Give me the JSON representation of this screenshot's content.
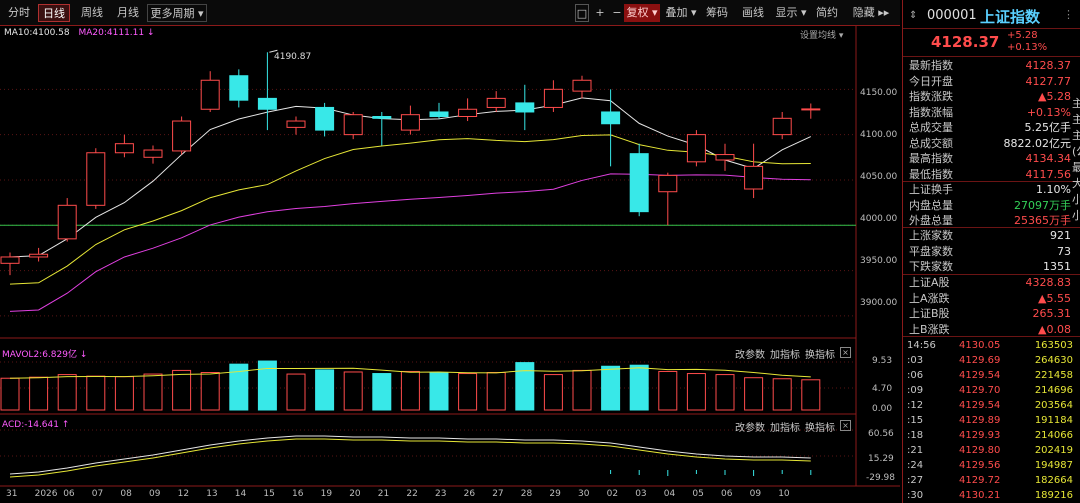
{
  "toolbar": {
    "periods": [
      "分时",
      "日线",
      "周线",
      "月线",
      "更多周期 ▾"
    ],
    "active_period": "日线",
    "icons": [
      "□",
      "+",
      "−"
    ],
    "adjust": "复权 ▾",
    "items": [
      "叠加 ▾",
      "筹码",
      "画线",
      "显示 ▾",
      "简约",
      "隐藏 ▸▸"
    ]
  },
  "ma": {
    "ma10": "MA10:4100.58",
    "ma20": "MA20:4111.11 ↓"
  },
  "settings_label": "设置均线 ▾",
  "high_marker": "4190.87",
  "y_axis_main": [
    "4150.00",
    "4100.00",
    "4050.00",
    "4000.00",
    "3950.00",
    "3900.00"
  ],
  "vol_panel": {
    "label": "MAVOL2:6.829亿 ↓",
    "y": [
      "9.53",
      "4.70",
      "0.00"
    ],
    "buttons": [
      "改参数",
      "加指标",
      "换指标"
    ]
  },
  "macd_panel": {
    "label": "ACD:-14.641 ↑",
    "y": [
      "60.56",
      "15.29",
      "-29.98"
    ],
    "buttons": [
      "改参数",
      "加指标",
      "换指标"
    ]
  },
  "x_labels": [
    "31",
    "2026",
    "06",
    "07",
    "08",
    "09",
    "12",
    "13",
    "14",
    "15",
    "16",
    "19",
    "20",
    "21",
    "22",
    "23",
    "26",
    "27",
    "28",
    "29",
    "30",
    "02",
    "03",
    "04",
    "05",
    "06",
    "09",
    "10"
  ],
  "chart_data": {
    "type": "candlestick",
    "candles": [
      {
        "o": 3958,
        "h": 3970,
        "l": 3945,
        "c": 3965
      },
      {
        "o": 3965,
        "h": 3975,
        "l": 3960,
        "c": 3968
      },
      {
        "o": 3985,
        "h": 4030,
        "l": 3982,
        "c": 4022
      },
      {
        "o": 4022,
        "h": 4085,
        "l": 4018,
        "c": 4080
      },
      {
        "o": 4080,
        "h": 4100,
        "l": 4075,
        "c": 4090
      },
      {
        "o": 4075,
        "h": 4088,
        "l": 4068,
        "c": 4083
      },
      {
        "o": 4082,
        "h": 4120,
        "l": 4078,
        "c": 4115
      },
      {
        "o": 4128,
        "h": 4170,
        "l": 4125,
        "c": 4160
      },
      {
        "o": 4165,
        "h": 4172,
        "l": 4130,
        "c": 4138
      },
      {
        "o": 4140,
        "h": 4190.87,
        "l": 4105,
        "c": 4128
      },
      {
        "o": 4108,
        "h": 4120,
        "l": 4100,
        "c": 4115
      },
      {
        "o": 4130,
        "h": 4135,
        "l": 4098,
        "c": 4105
      },
      {
        "o": 4100,
        "h": 4125,
        "l": 4095,
        "c": 4122
      },
      {
        "o": 4120,
        "h": 4125,
        "l": 4088,
        "c": 4118
      },
      {
        "o": 4105,
        "h": 4132,
        "l": 4100,
        "c": 4122
      },
      {
        "o": 4125,
        "h": 4135,
        "l": 4118,
        "c": 4120
      },
      {
        "o": 4120,
        "h": 4140,
        "l": 4115,
        "c": 4128
      },
      {
        "o": 4130,
        "h": 4148,
        "l": 4125,
        "c": 4140
      },
      {
        "o": 4135,
        "h": 4155,
        "l": 4105,
        "c": 4125
      },
      {
        "o": 4130,
        "h": 4160,
        "l": 4125,
        "c": 4150
      },
      {
        "o": 4148,
        "h": 4165,
        "l": 4140,
        "c": 4160
      },
      {
        "o": 4125,
        "h": 4150,
        "l": 4065,
        "c": 4112
      },
      {
        "o": 4079,
        "h": 4090,
        "l": 4010,
        "c": 4015
      },
      {
        "o": 4037,
        "h": 4058,
        "l": 4000,
        "c": 4055
      },
      {
        "o": 4070,
        "h": 4105,
        "l": 4065,
        "c": 4100
      },
      {
        "o": 4072,
        "h": 4090,
        "l": 4060,
        "c": 4078
      },
      {
        "o": 4040,
        "h": 4090,
        "l": 4030,
        "c": 4065
      },
      {
        "o": 4100,
        "h": 4125,
        "l": 4095,
        "c": 4118
      },
      {
        "o": 4127.77,
        "h": 4134.34,
        "l": 4117.56,
        "c": 4128.37
      }
    ],
    "ylim": [
      3880,
      4200
    ]
  },
  "quote": {
    "code": "000001",
    "name": "上证指数",
    "price": "4128.37",
    "change": "+5.28",
    "pct": "+0.13%",
    "rows1": [
      {
        "k": "最新指数",
        "v": "4128.37",
        "c": "red"
      },
      {
        "k": "今日开盘",
        "v": "4127.77",
        "c": "red"
      },
      {
        "k": "指数涨跌",
        "v": "▲5.28",
        "c": "red"
      },
      {
        "k": "指数涨幅",
        "v": "+0.13%",
        "c": "red"
      },
      {
        "k": "总成交量",
        "v": "5.25亿手",
        "c": "white"
      },
      {
        "k": "总成交额",
        "v": "8822.02亿元",
        "c": "white"
      },
      {
        "k": "最高指数",
        "v": "4134.34",
        "c": "red"
      },
      {
        "k": "最低指数",
        "v": "4117.56",
        "c": "red"
      }
    ],
    "rows2": [
      {
        "k": "上证换手",
        "v": "1.10%",
        "c": "white"
      },
      {
        "k": "内盘总量",
        "v": "27097万手",
        "c": "green"
      },
      {
        "k": "外盘总量",
        "v": "25365万手",
        "c": "red"
      }
    ],
    "rows3": [
      {
        "k": "上涨家数",
        "v": "921",
        "c": "white"
      },
      {
        "k": "平盘家数",
        "v": "73",
        "c": "white"
      },
      {
        "k": "下跌家数",
        "v": "1351",
        "c": "white"
      }
    ],
    "rows4": [
      {
        "k": "上证A股",
        "v": "4328.83",
        "c": "red"
      },
      {
        "k": "上A涨跌",
        "v": "▲5.55",
        "c": "red"
      },
      {
        "k": "上证B股",
        "v": "265.31",
        "c": "red"
      },
      {
        "k": "上B涨跌",
        "v": "▲0.08",
        "c": "red"
      }
    ],
    "ticks": [
      {
        "t": "14:56",
        "p": "4130.05",
        "v": "163503"
      },
      {
        "t": ":03",
        "p": "4129.69",
        "v": "264630"
      },
      {
        "t": ":06",
        "p": "4129.54",
        "v": "221458"
      },
      {
        "t": ":09",
        "p": "4129.70",
        "v": "214696"
      },
      {
        "t": ":12",
        "p": "4129.54",
        "v": "203564"
      },
      {
        "t": ":15",
        "p": "4129.89",
        "v": "191184"
      },
      {
        "t": ":18",
        "p": "4129.93",
        "v": "214066"
      },
      {
        "t": ":21",
        "p": "4129.80",
        "v": "202419"
      },
      {
        "t": ":24",
        "p": "4129.56",
        "v": "194987"
      },
      {
        "t": ":27",
        "p": "4129.72",
        "v": "182664"
      },
      {
        "t": ":30",
        "p": "4130.21",
        "v": "189216"
      }
    ]
  }
}
